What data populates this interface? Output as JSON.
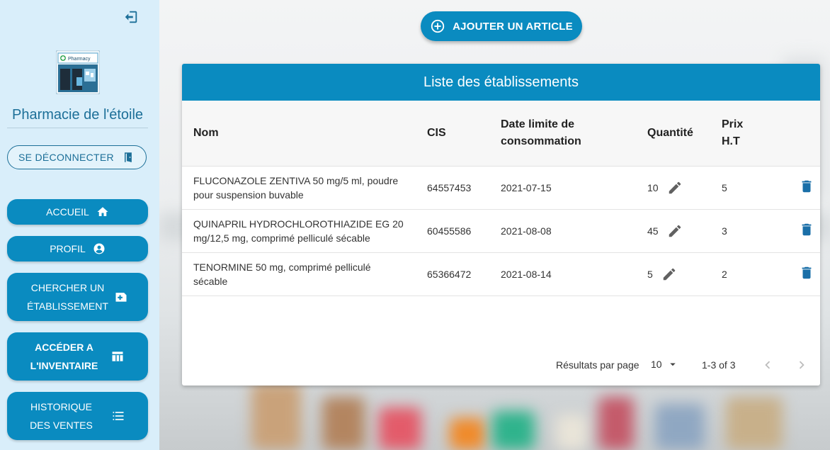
{
  "sidebar": {
    "pharmacy_name": "Pharmacie de l'étoile",
    "logo_text": "Pharmacy",
    "logout_label": "SE DÉCONNECTER",
    "nav": {
      "accueil": "ACCUEIL",
      "profil": "PROFIL",
      "chercher_line1": "CHERCHER UN",
      "chercher_line2": "ÉTABLISSEMENT",
      "inventaire_line1": "ACCÉDER A",
      "inventaire_line2": "L'INVENTAIRE",
      "historique_line1": "HISTORIQUE",
      "historique_line2": "DES VENTES"
    }
  },
  "add_button_label": "AJOUTER UN ARTICLE",
  "table": {
    "title": "Liste des établissements",
    "headers": {
      "nom": "Nom",
      "cis": "CIS",
      "date_line1": "Date limite de",
      "date_line2": "consommation",
      "quantite": "Quantité",
      "prix_line1": "Prix",
      "prix_line2": "H.T"
    },
    "rows": [
      {
        "nom_line1": "FLUCONAZOLE ZENTIVA 50 mg/5 ml, poudre",
        "nom_line2": "pour suspension buvable",
        "cis": "64557453",
        "date": "2021-07-15",
        "quantite": "10",
        "prix": "5"
      },
      {
        "nom_line1": "QUINAPRIL HYDROCHLOROTHIAZIDE EG 20",
        "nom_line2": "mg/12,5 mg, comprimé pelliculé sécable",
        "cis": "60455586",
        "date": "2021-08-08",
        "quantite": "45",
        "prix": "3"
      },
      {
        "nom_line1": "TENORMINE 50 mg, comprimé pelliculé",
        "nom_line2": "sécable",
        "cis": "65366472",
        "date": "2021-08-14",
        "quantite": "5",
        "prix": "2"
      }
    ],
    "footer": {
      "rows_per_page_label": "Résultats par page",
      "rows_per_page_value": "10",
      "range": "1-3 of 3"
    }
  },
  "colors": {
    "primary": "#0a8bc0",
    "sidebar_bg": "#d9eefa",
    "delete_icon": "#1a6fa8"
  },
  "icons": [
    "collapse-sidebar-icon",
    "home-icon",
    "account-circle-icon",
    "search-pharmacy-icon",
    "table-icon",
    "list-icon",
    "door-icon",
    "plus-circle-icon",
    "pencil-icon",
    "trash-icon",
    "chevron-left-icon",
    "chevron-right-icon",
    "arrow-drop-down-icon"
  ]
}
